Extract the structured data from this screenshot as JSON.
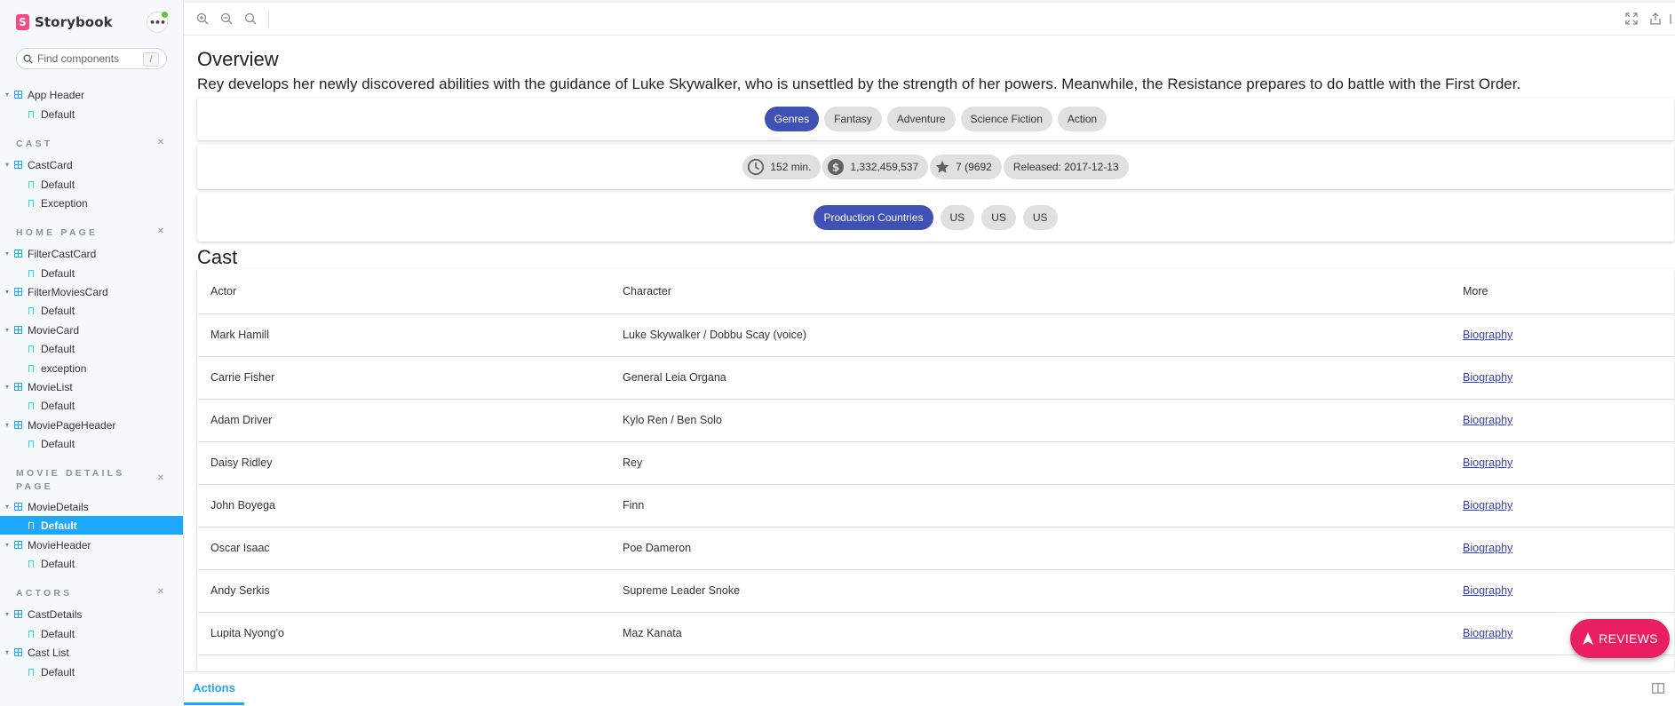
{
  "sidebar": {
    "brand": "Storybook",
    "menu_label": "•••",
    "search": {
      "placeholder": "Find components",
      "shortcut": "/"
    },
    "sections": {
      "cast": "CAST",
      "home_page": "HOME PAGE",
      "movie_details_page": "MOVIE DETAILS PAGE",
      "actors": "ACTORS"
    },
    "tree": {
      "app_header": "App Header",
      "app_header_default": "Default",
      "cast_card": "CastCard",
      "cast_card_default": "Default",
      "cast_card_exception": "Exception",
      "filter_cast_card": "FilterCastCard",
      "filter_cast_card_default": "Default",
      "filter_movies_card": "FilterMoviesCard",
      "filter_movies_card_default": "Default",
      "movie_card": "MovieCard",
      "movie_card_default": "Default",
      "movie_card_exception": "exception",
      "movie_list": "MovieList",
      "movie_list_default": "Default",
      "movie_page_header": "MoviePageHeader",
      "movie_page_header_default": "Default",
      "movie_details": "MovieDetails",
      "movie_details_default": "Default",
      "movie_header": "MovieHeader",
      "movie_header_default": "Default",
      "cast_details": "CastDetails",
      "cast_details_default": "Default",
      "cast_list": "Cast List",
      "cast_list_default": "Default"
    }
  },
  "main": {
    "overview_title": "Overview",
    "overview_text": "Rey develops her newly discovered abilities with the guidance of Luke Skywalker, who is unsettled by the strength of her powers. Meanwhile, the Resistance prepares to do battle with the First Order.",
    "genres": {
      "label": "Genres",
      "items": [
        "Fantasy",
        "Adventure",
        "Science Fiction",
        "Action"
      ]
    },
    "stats": {
      "runtime": "152 min.",
      "revenue": "1,332,459,537",
      "rating": "7 (9692",
      "released": "Released: 2017-12-13"
    },
    "countries": {
      "label": "Production Countries",
      "items": [
        "US",
        "US",
        "US"
      ]
    },
    "cast_title": "Cast",
    "cast_table": {
      "headers": {
        "actor": "Actor",
        "character": "Character",
        "more": "More"
      },
      "rows": [
        {
          "actor": "Mark Hamill",
          "character": "Luke Skywalker / Dobbu Scay (voice)",
          "more": "Biography"
        },
        {
          "actor": "Carrie Fisher",
          "character": "General Leia Organa",
          "more": "Biography"
        },
        {
          "actor": "Adam Driver",
          "character": "Kylo Ren / Ben Solo",
          "more": "Biography"
        },
        {
          "actor": "Daisy Ridley",
          "character": "Rey",
          "more": "Biography"
        },
        {
          "actor": "John Boyega",
          "character": "Finn",
          "more": "Biography"
        },
        {
          "actor": "Oscar Isaac",
          "character": "Poe Dameron",
          "more": "Biography"
        },
        {
          "actor": "Andy Serkis",
          "character": "Supreme Leader Snoke",
          "more": "Biography"
        },
        {
          "actor": "Lupita Nyong'o",
          "character": "Maz Kanata",
          "more": "Biography"
        }
      ]
    },
    "fab_label": "REVIEWS"
  },
  "bottom_panel": {
    "active_tab": "Actions"
  },
  "colors": {
    "accent": "#1ea7fd",
    "storybook_pink": "#ff4785",
    "chip_primary": "#3f51b5",
    "fab": "#e91e63",
    "link": "#3b3bc4"
  }
}
